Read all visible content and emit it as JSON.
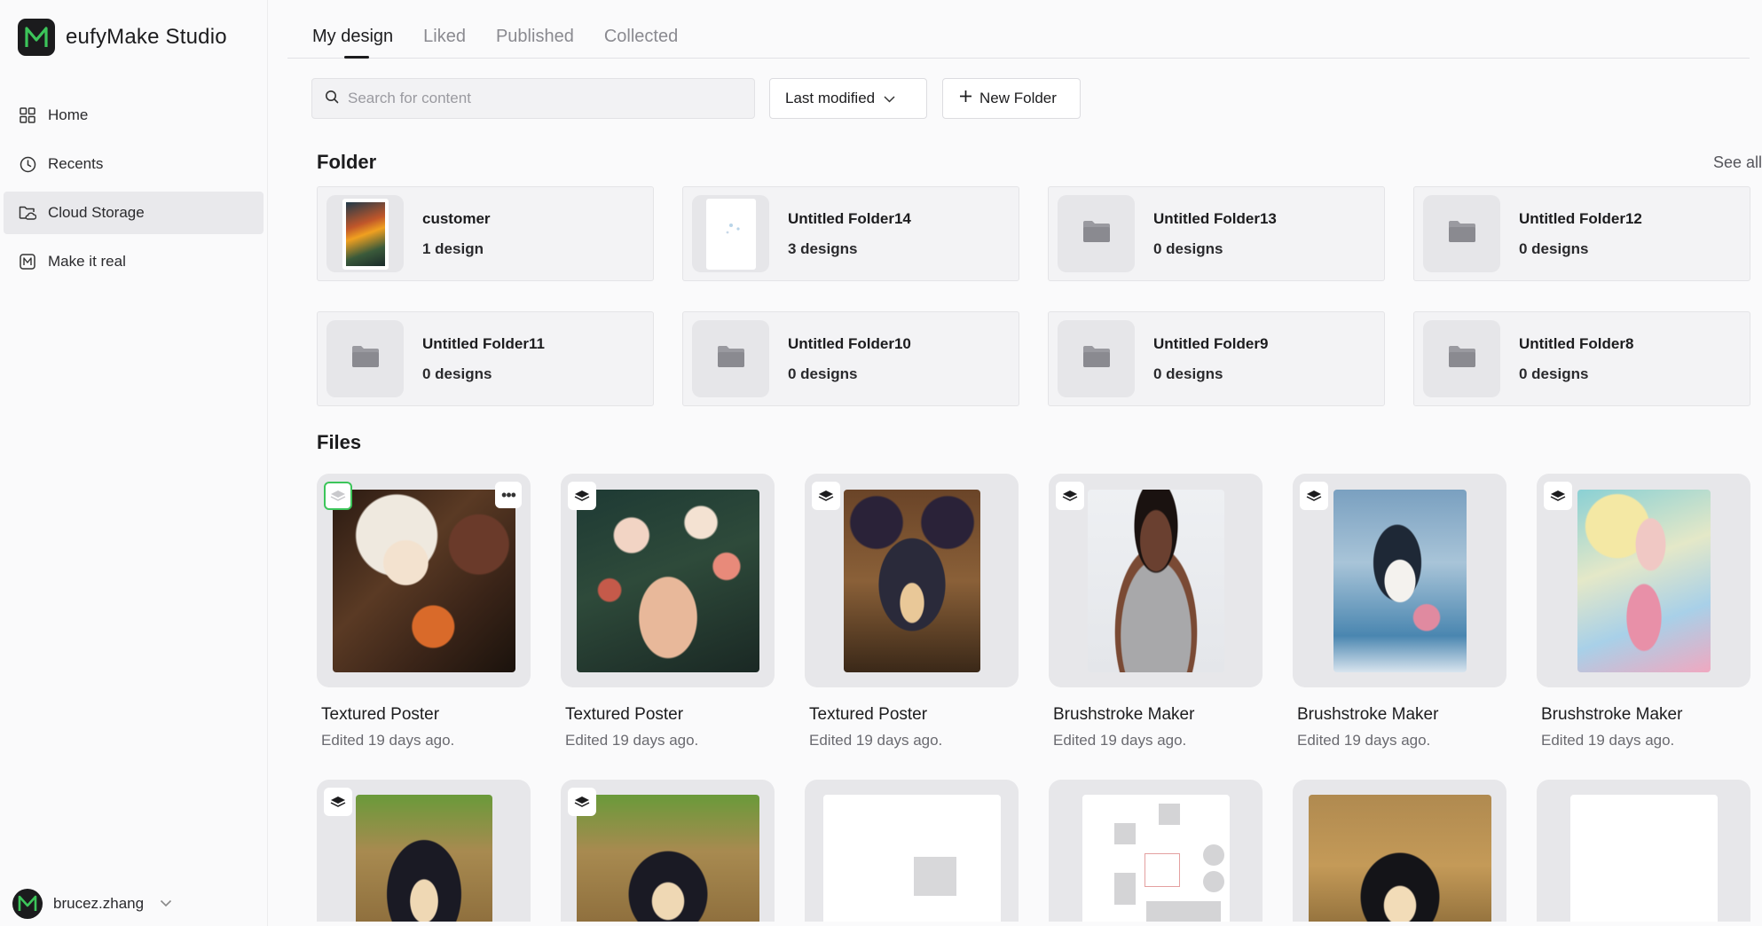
{
  "app": {
    "name": "eufyMake Studio"
  },
  "sidebar": {
    "items": [
      {
        "label": "Home",
        "icon": "grid-icon",
        "active": false
      },
      {
        "label": "Recents",
        "icon": "clock-icon",
        "active": false
      },
      {
        "label": "Cloud Storage",
        "icon": "cloud-folder-icon",
        "active": true
      },
      {
        "label": "Make it real",
        "icon": "m-logo-icon",
        "active": false
      }
    ],
    "user": {
      "name": "brucez.zhang"
    }
  },
  "tabs": [
    "My design",
    "Liked",
    "Published",
    "Collected"
  ],
  "toolbar": {
    "search_placeholder": "Search for content",
    "sort_label": "Last modified",
    "new_folder_label": "New Folder"
  },
  "folders": {
    "title": "Folder",
    "see_all": "See all",
    "items": [
      {
        "name": "customer",
        "count": "1 design"
      },
      {
        "name": "Untitled Folder14",
        "count": "3 designs"
      },
      {
        "name": "Untitled Folder13",
        "count": "0 designs"
      },
      {
        "name": "Untitled Folder12",
        "count": "0 designs"
      },
      {
        "name": "Untitled Folder11",
        "count": "0 designs"
      },
      {
        "name": "Untitled Folder10",
        "count": "0 designs"
      },
      {
        "name": "Untitled Folder9",
        "count": "0 designs"
      },
      {
        "name": "Untitled Folder8",
        "count": "0 designs"
      }
    ]
  },
  "files": {
    "title": "Files",
    "items": [
      {
        "name": "Textured Poster",
        "edited": "Edited 19 days ago."
      },
      {
        "name": "Textured Poster",
        "edited": "Edited 19 days ago."
      },
      {
        "name": "Textured Poster",
        "edited": "Edited 19 days ago."
      },
      {
        "name": "Brushstroke Maker",
        "edited": "Edited 19 days ago."
      },
      {
        "name": "Brushstroke Maker",
        "edited": "Edited 19 days ago."
      },
      {
        "name": "Brushstroke Maker",
        "edited": "Edited 19 days ago."
      }
    ]
  },
  "colors": {
    "accent": "#1b1b1d",
    "brand_green": "#3cc55a",
    "active_nav": "#e9e9ec"
  }
}
